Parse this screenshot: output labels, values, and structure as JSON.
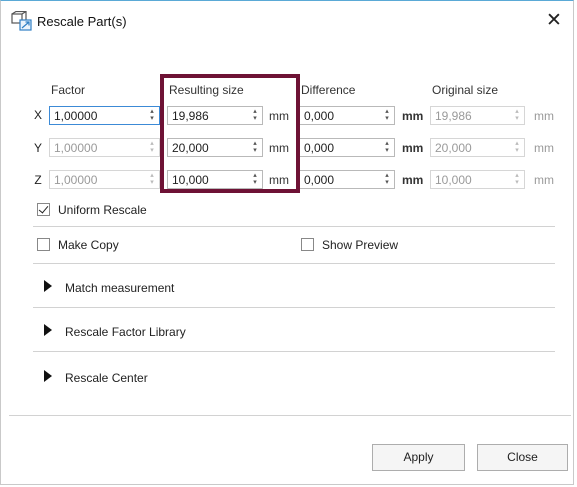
{
  "window": {
    "title": "Rescale Part(s)",
    "close_glyph": "✕",
    "icon": "rescale-parts-icon"
  },
  "headers": {
    "factor": "Factor",
    "resulting": "Resulting size",
    "difference": "Difference",
    "original": "Original size"
  },
  "rows": [
    {
      "axis": "X",
      "factor": "1,00000",
      "resulting": "19,986",
      "unit1": "mm",
      "difference": "0,000",
      "unit2": "mm",
      "original": "19,986",
      "unit3": "mm"
    },
    {
      "axis": "Y",
      "factor": "1,00000",
      "resulting": "20,000",
      "unit1": "mm",
      "difference": "0,000",
      "unit2": "mm",
      "original": "20,000",
      "unit3": "mm"
    },
    {
      "axis": "Z",
      "factor": "1,00000",
      "resulting": "10,000",
      "unit1": "mm",
      "difference": "0,000",
      "unit2": "mm",
      "original": "10,000",
      "unit3": "mm"
    }
  ],
  "options": {
    "uniform_rescale": {
      "label": "Uniform Rescale",
      "checked": true
    },
    "make_copy": {
      "label": "Make Copy",
      "checked": false
    },
    "show_preview": {
      "label": "Show Preview",
      "checked": false
    }
  },
  "sections": [
    {
      "label": "Match measurement"
    },
    {
      "label": "Rescale Factor Library"
    },
    {
      "label": "Rescale Center"
    }
  ],
  "buttons": {
    "apply": "Apply",
    "close": "Close"
  },
  "colors": {
    "highlight": "#6e1235",
    "accent": "#3c8ad6"
  }
}
